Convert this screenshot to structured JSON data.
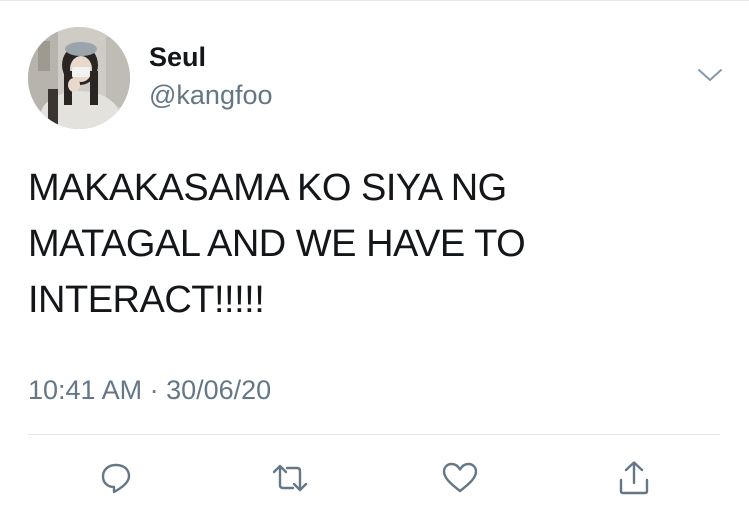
{
  "tweet": {
    "author": {
      "name": "Seul",
      "handle": "@kangfoo"
    },
    "text": "MAKAKASAMA KO SIYA NG\nMATAGAL AND WE HAVE TO\nINTERACT!!!!!",
    "time": "10:41 AM",
    "separator": " · ",
    "date": "30/06/20"
  },
  "icons": {
    "caret": "chevron-down-icon",
    "reply": "reply-icon",
    "retweet": "retweet-icon",
    "like": "heart-icon",
    "share": "share-icon"
  },
  "colors": {
    "text_primary": "#14171a",
    "text_secondary": "#657786",
    "icon": "#657786",
    "divider": "#e1e8ed"
  }
}
